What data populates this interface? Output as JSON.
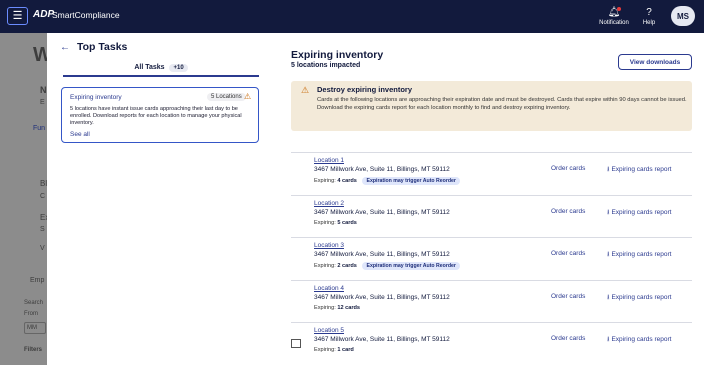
{
  "header": {
    "logo_text": "ADP",
    "app_title": "SmartCompliance",
    "notification_label": "Notification",
    "help_label": "Help",
    "avatar_initials": "MS"
  },
  "background": {
    "fragments": [
      "W",
      "N",
      "E",
      "Fun",
      "Bl",
      "C",
      "Ex",
      "S",
      "V",
      "Emp",
      "Search",
      "From",
      "MM",
      "Filters"
    ]
  },
  "drawer": {
    "title": "Top Tasks",
    "tab_label": "All Tasks",
    "tab_count": "+10",
    "task": {
      "name": "Expiring inventory",
      "badge": "5 Locations",
      "description": "5 locations have instant issue cards approaching their last day to be enrolled. Download reports for each location to manage your physical inventory.",
      "link": "See all"
    }
  },
  "main": {
    "title": "Expiring inventory",
    "subtitle": "5 locations impacted",
    "view_downloads": "View downloads",
    "alert": {
      "title": "Destroy expiring inventory",
      "text": "Cards at the following locations are approaching their expiration date and must be destroyed. Cards that expire within 90 days cannot be issued. Download the expiring cards report for each location monthly to find and destroy expiring inventory."
    },
    "order_label": "Order cards",
    "report_label": "Expiring cards report",
    "expiring_prefix": "Expiring:",
    "locations": [
      {
        "name": "Location 1",
        "address": "3467 Millwork Ave, Suite 11, Billings, MT 59112",
        "expiring": "4 cards",
        "badge": "Expiration may trigger Auto Reorder"
      },
      {
        "name": "Location 2",
        "address": "3467 Millwork Ave, Suite 11, Billings, MT 59112",
        "expiring": "5 cards",
        "badge": ""
      },
      {
        "name": "Location 3",
        "address": "3467 Millwork Ave, Suite 11, Billings, MT 59112",
        "expiring": "2 cards",
        "badge": "Expiration may trigger Auto Reorder"
      },
      {
        "name": "Location 4",
        "address": "3467 Millwork Ave, Suite 11, Billings, MT 59112",
        "expiring": "12 cards",
        "badge": ""
      },
      {
        "name": "Location 5",
        "address": "3467 Millwork Ave, Suite 11, Billings, MT 59112",
        "expiring": "1 card",
        "badge": ""
      }
    ]
  }
}
